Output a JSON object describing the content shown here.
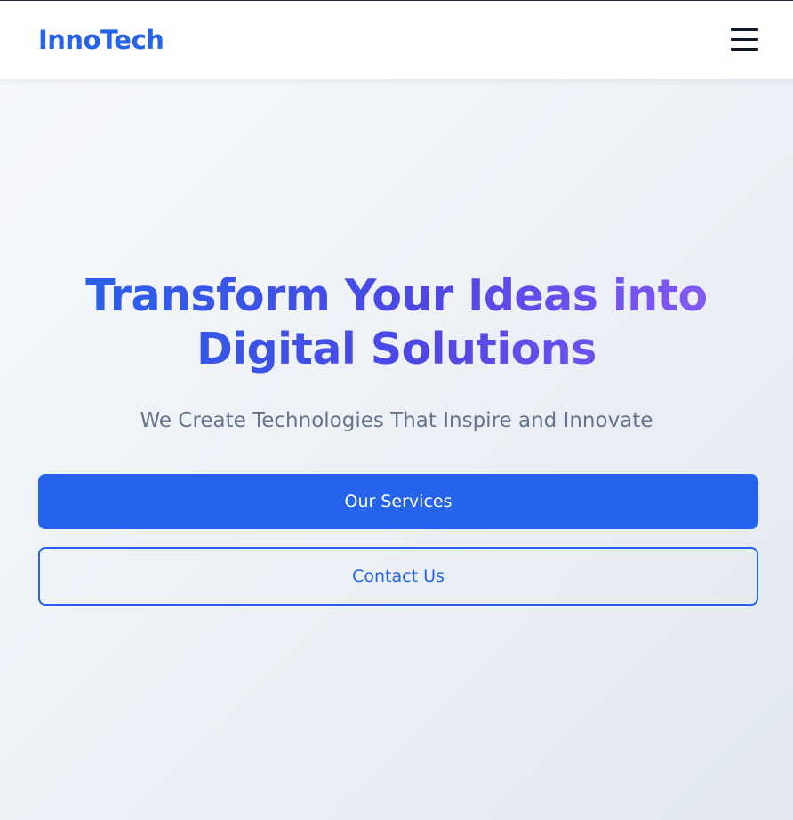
{
  "header": {
    "logo_text": "InnoTech",
    "menu_icon": "hamburger-menu-icon"
  },
  "hero": {
    "title": "Transform Your Ideas into Digital Solutions",
    "subtitle": "We Create Technologies That Inspire and Innovate",
    "primary_button_label": "Our Services",
    "secondary_button_label": "Contact Us"
  },
  "colors": {
    "brand": "#2563eb",
    "title_gradient_start": "#2563eb",
    "title_gradient_end": "#8b5cf6",
    "subtitle_text": "#64748b",
    "menu_icon": "#111827"
  }
}
